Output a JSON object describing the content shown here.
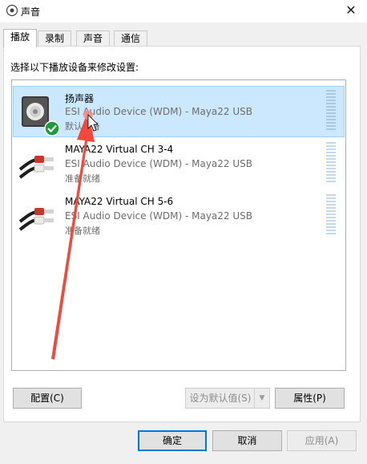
{
  "window": {
    "title": "声音",
    "close_glyph": "✕"
  },
  "tabs": [
    {
      "label": "播放",
      "active": true
    },
    {
      "label": "录制",
      "active": false
    },
    {
      "label": "声音",
      "active": false
    },
    {
      "label": "通信",
      "active": false
    }
  ],
  "instruction": "选择以下播放设备来修改设置:",
  "devices": [
    {
      "name": "扬声器",
      "description": "ESI Audio Device (WDM) - Maya22 USB",
      "status": "默认设备",
      "icon": "speaker-icon",
      "selected": true,
      "default": true
    },
    {
      "name": "MAYA22 Virtual CH 3-4",
      "description": "ESI Audio Device (WDM) - Maya22 USB",
      "status": "准备就绪",
      "icon": "rca-cable-icon",
      "selected": false,
      "default": false
    },
    {
      "name": "MAYA22 Virtual CH 5-6",
      "description": "ESI Audio Device (WDM) - Maya22 USB",
      "status": "准备就绪",
      "icon": "rca-cable-icon",
      "selected": false,
      "default": false
    }
  ],
  "panel_buttons": {
    "configure": "配置(C)",
    "set_default": "设为默认值(S)",
    "properties": "属性(P)"
  },
  "footer_buttons": {
    "ok": "确定",
    "cancel": "取消",
    "apply": "应用(A)"
  },
  "colors": {
    "selection": "#cce8ff",
    "accent": "#0078d7",
    "annotation_arrow": "#f04a3e",
    "check_badge": "#1a9c3a"
  }
}
